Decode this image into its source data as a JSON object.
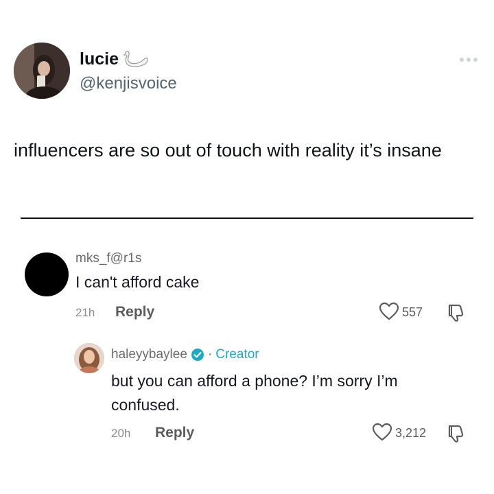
{
  "tweet": {
    "display_name": "lucie",
    "handle": "@kenjisvoice",
    "emoji_icon": "swan-icon",
    "text": "influencers are so out of touch with reality it’s insane"
  },
  "comments": [
    {
      "username": "mks_f@r1s",
      "text": "I can't afford cake",
      "time": "21h",
      "reply_label": "Reply",
      "likes": "557"
    },
    {
      "username": "haleyybaylee",
      "separator": "·",
      "badge": "Creator",
      "text": "but you can afford a phone? I’m sorry I’m confused.",
      "time": "20h",
      "reply_label": "Reply",
      "likes": "3,212"
    }
  ],
  "colors": {
    "creator_accent": "#20a9c4",
    "handle_gray": "#536471",
    "verified_badge": "#20a9c4"
  }
}
